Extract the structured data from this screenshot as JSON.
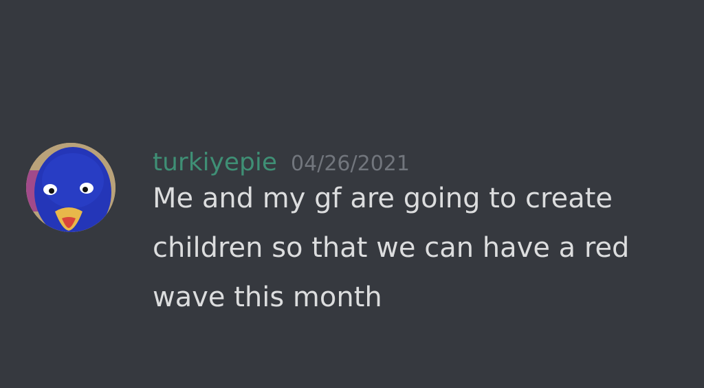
{
  "message": {
    "username": "turkiyepie",
    "timestamp": "04/26/2021",
    "text": "Me and my gf are going to create children so that we can have a red wave this month",
    "username_color": "#3f8f75"
  }
}
